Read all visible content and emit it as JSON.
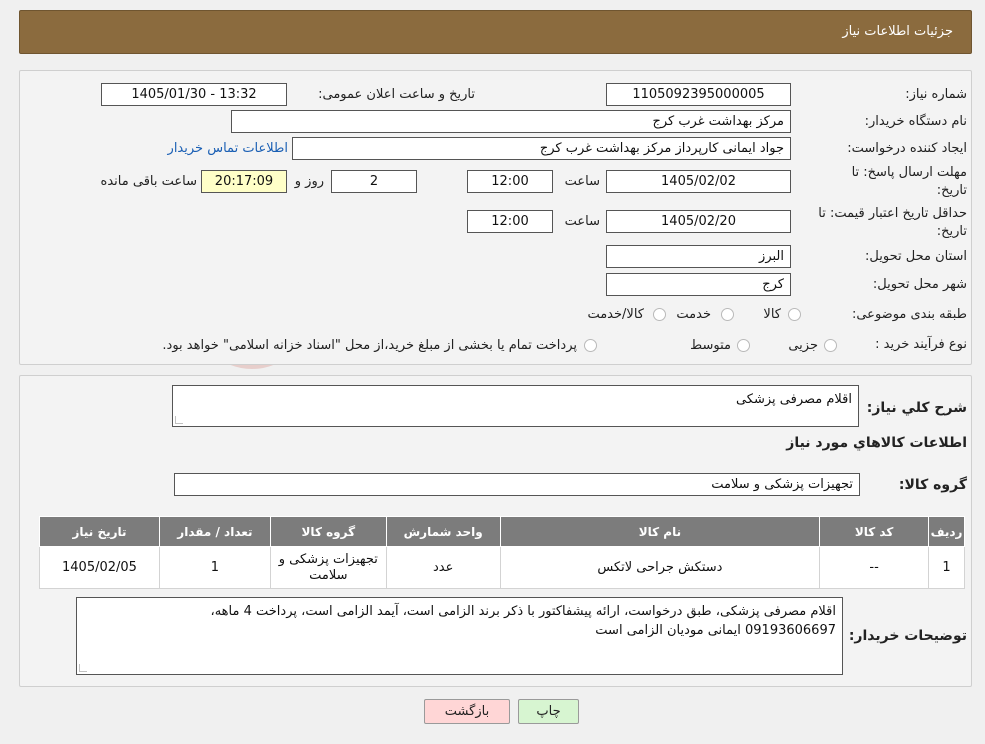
{
  "header": {
    "title": "جزئیات اطلاعات نیاز"
  },
  "fields": {
    "need_number_label": "شماره نیاز:",
    "need_number": "1105092395000005",
    "announce_label": "تاریخ و ساعت اعلان عمومی:",
    "announce_value": "1405/01/30 - 13:32",
    "buyer_label": "نام دستگاه خریدار:",
    "buyer_value": "مرکز بهداشت غرب کرج",
    "creator_label": "ایجاد کننده درخواست:",
    "creator_value": "جواد ایمانی کارپرداز مرکز بهداشت غرب کرج",
    "contact_link": "اطلاعات تماس خریدار",
    "deadline_label_1": "مهلت ارسال پاسخ: تا",
    "deadline_label_2": "تاریخ:",
    "deadline_date": "1405/02/02",
    "time_label": "ساعت",
    "deadline_time": "12:00",
    "days_value": "2",
    "days_label": "روز و",
    "remaining_time": "20:17:09",
    "remaining_label": "ساعت باقی مانده",
    "validity_label_1": "حداقل تاریخ اعتبار قیمت: تا",
    "validity_label_2": "تاریخ:",
    "validity_date": "1405/02/20",
    "validity_time": "12:00",
    "province_label": "استان محل تحویل:",
    "province_value": "البرز",
    "city_label": "شهر محل تحویل:",
    "city_value": "کرج",
    "category_label": "طبقه بندی موضوعی:",
    "category_options": [
      "کالا",
      "خدمت",
      "کالا/خدمت"
    ],
    "process_label": "نوع فرآیند خرید :",
    "process_options": [
      "جزیی",
      "متوسط"
    ],
    "process_note": "پرداخت تمام یا بخشی از مبلغ خرید،از محل \"اسناد خزانه اسلامی\" خواهد بود."
  },
  "summary": {
    "label": "شرح کلي نياز:",
    "value": "اقلام مصرفی پزشکی",
    "goods_info_title": "اطلاعات کالاهاي مورد نياز",
    "group_label": "گروه کالا:",
    "group_value": "تجهیزات پزشکی و سلامت"
  },
  "table": {
    "headers": [
      "ردیف",
      "کد کالا",
      "نام کالا",
      "واحد شمارش",
      "گروه کالا",
      "تعداد / مقدار",
      "تاریخ نیاز"
    ],
    "rows": [
      [
        "1",
        "--",
        "دستکش جراحی لاتکس",
        "عدد",
        "تجهیزات پزشکی و سلامت",
        "1",
        "1405/02/05"
      ]
    ]
  },
  "buyer_notes": {
    "label": "توضیحات خریدار:",
    "line1": "اقلام مصرفی پزشکی، طبق درخواست، ارائه پیشفاکتور با ذکر برند الزامی است، آیمد الزامی است، پرداخت 4 ماهه،",
    "line2": "09193606697 ایمانی  مودیان الزامی است"
  },
  "buttons": {
    "print": "چاپ",
    "back": "بازگشت"
  },
  "watermark": {
    "text": "AriaTender.neT"
  },
  "colors": {
    "header_bg": "#8b6b3e",
    "back_btn_bg": "#ffd6d6",
    "print_btn_bg": "#d7f5d1",
    "remaining_bg": "#ffffc8",
    "link": "#1a5fb4"
  }
}
